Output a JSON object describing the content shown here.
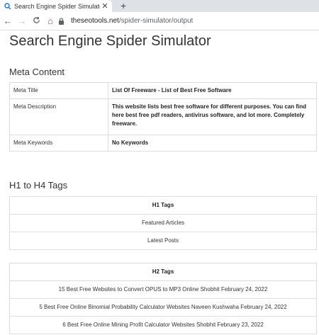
{
  "browser": {
    "tab_title": "Search Engine Spider Simulator |",
    "tab_close": "✕",
    "new_tab": "+",
    "nav_back": "←",
    "nav_forward": "→",
    "nav_reload": "C",
    "nav_home": "⌂",
    "url_host": "theseotools.net",
    "url_path": "/spider-simulator/output"
  },
  "page": {
    "title": "Search Engine Spider Simulator",
    "meta_heading": "Meta Content",
    "meta_rows": [
      {
        "key": "Meta Title",
        "value": "List Of Freeware - List of Best Free Software"
      },
      {
        "key": "Meta Description",
        "value": "This website lists best free software for different purposes. You can find here best free pdf readers, antivirus software, and lot more. Completely freeware."
      },
      {
        "key": "Meta Keywords",
        "value": "No Keywords"
      }
    ],
    "headings_heading": "H1 to H4 Tags",
    "h1": {
      "label": "H1 Tags",
      "items": [
        "Featured Articles",
        "Latest Posts"
      ]
    },
    "h2": {
      "label": "H2 Tags",
      "items": [
        "15 Best Free Websites to Convert OPUS to MP3 Online Shobhit February 24, 2022",
        "5 Best Free Online Binomial Probability Calculator Websites Naveen Kushwaha February 24, 2022",
        "6 Best Free Online Mining Profit Calculator Websites Shobhit February 23, 2022"
      ]
    }
  }
}
